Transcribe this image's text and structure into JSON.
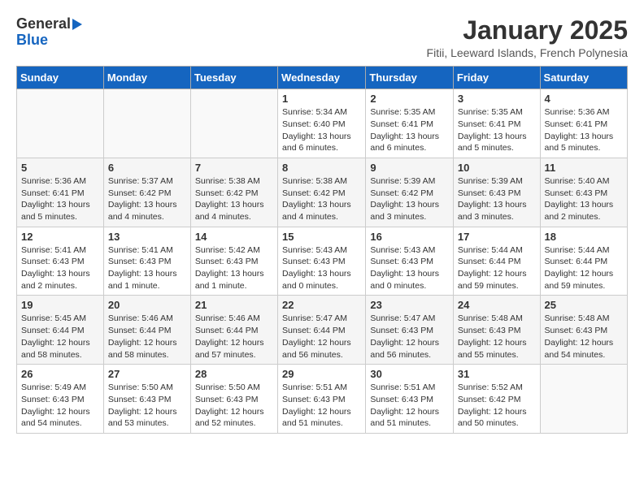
{
  "logo": {
    "general": "General",
    "blue": "Blue"
  },
  "title": "January 2025",
  "subtitle": "Fitii, Leeward Islands, French Polynesia",
  "weekdays": [
    "Sunday",
    "Monday",
    "Tuesday",
    "Wednesday",
    "Thursday",
    "Friday",
    "Saturday"
  ],
  "weeks": [
    [
      {
        "day": "",
        "info": ""
      },
      {
        "day": "",
        "info": ""
      },
      {
        "day": "",
        "info": ""
      },
      {
        "day": "1",
        "info": "Sunrise: 5:34 AM\nSunset: 6:40 PM\nDaylight: 13 hours\nand 6 minutes."
      },
      {
        "day": "2",
        "info": "Sunrise: 5:35 AM\nSunset: 6:41 PM\nDaylight: 13 hours\nand 6 minutes."
      },
      {
        "day": "3",
        "info": "Sunrise: 5:35 AM\nSunset: 6:41 PM\nDaylight: 13 hours\nand 5 minutes."
      },
      {
        "day": "4",
        "info": "Sunrise: 5:36 AM\nSunset: 6:41 PM\nDaylight: 13 hours\nand 5 minutes."
      }
    ],
    [
      {
        "day": "5",
        "info": "Sunrise: 5:36 AM\nSunset: 6:41 PM\nDaylight: 13 hours\nand 5 minutes."
      },
      {
        "day": "6",
        "info": "Sunrise: 5:37 AM\nSunset: 6:42 PM\nDaylight: 13 hours\nand 4 minutes."
      },
      {
        "day": "7",
        "info": "Sunrise: 5:38 AM\nSunset: 6:42 PM\nDaylight: 13 hours\nand 4 minutes."
      },
      {
        "day": "8",
        "info": "Sunrise: 5:38 AM\nSunset: 6:42 PM\nDaylight: 13 hours\nand 4 minutes."
      },
      {
        "day": "9",
        "info": "Sunrise: 5:39 AM\nSunset: 6:42 PM\nDaylight: 13 hours\nand 3 minutes."
      },
      {
        "day": "10",
        "info": "Sunrise: 5:39 AM\nSunset: 6:43 PM\nDaylight: 13 hours\nand 3 minutes."
      },
      {
        "day": "11",
        "info": "Sunrise: 5:40 AM\nSunset: 6:43 PM\nDaylight: 13 hours\nand 2 minutes."
      }
    ],
    [
      {
        "day": "12",
        "info": "Sunrise: 5:41 AM\nSunset: 6:43 PM\nDaylight: 13 hours\nand 2 minutes."
      },
      {
        "day": "13",
        "info": "Sunrise: 5:41 AM\nSunset: 6:43 PM\nDaylight: 13 hours\nand 1 minute."
      },
      {
        "day": "14",
        "info": "Sunrise: 5:42 AM\nSunset: 6:43 PM\nDaylight: 13 hours\nand 1 minute."
      },
      {
        "day": "15",
        "info": "Sunrise: 5:43 AM\nSunset: 6:43 PM\nDaylight: 13 hours\nand 0 minutes."
      },
      {
        "day": "16",
        "info": "Sunrise: 5:43 AM\nSunset: 6:43 PM\nDaylight: 13 hours\nand 0 minutes."
      },
      {
        "day": "17",
        "info": "Sunrise: 5:44 AM\nSunset: 6:44 PM\nDaylight: 12 hours\nand 59 minutes."
      },
      {
        "day": "18",
        "info": "Sunrise: 5:44 AM\nSunset: 6:44 PM\nDaylight: 12 hours\nand 59 minutes."
      }
    ],
    [
      {
        "day": "19",
        "info": "Sunrise: 5:45 AM\nSunset: 6:44 PM\nDaylight: 12 hours\nand 58 minutes."
      },
      {
        "day": "20",
        "info": "Sunrise: 5:46 AM\nSunset: 6:44 PM\nDaylight: 12 hours\nand 58 minutes."
      },
      {
        "day": "21",
        "info": "Sunrise: 5:46 AM\nSunset: 6:44 PM\nDaylight: 12 hours\nand 57 minutes."
      },
      {
        "day": "22",
        "info": "Sunrise: 5:47 AM\nSunset: 6:44 PM\nDaylight: 12 hours\nand 56 minutes."
      },
      {
        "day": "23",
        "info": "Sunrise: 5:47 AM\nSunset: 6:43 PM\nDaylight: 12 hours\nand 56 minutes."
      },
      {
        "day": "24",
        "info": "Sunrise: 5:48 AM\nSunset: 6:43 PM\nDaylight: 12 hours\nand 55 minutes."
      },
      {
        "day": "25",
        "info": "Sunrise: 5:48 AM\nSunset: 6:43 PM\nDaylight: 12 hours\nand 54 minutes."
      }
    ],
    [
      {
        "day": "26",
        "info": "Sunrise: 5:49 AM\nSunset: 6:43 PM\nDaylight: 12 hours\nand 54 minutes."
      },
      {
        "day": "27",
        "info": "Sunrise: 5:50 AM\nSunset: 6:43 PM\nDaylight: 12 hours\nand 53 minutes."
      },
      {
        "day": "28",
        "info": "Sunrise: 5:50 AM\nSunset: 6:43 PM\nDaylight: 12 hours\nand 52 minutes."
      },
      {
        "day": "29",
        "info": "Sunrise: 5:51 AM\nSunset: 6:43 PM\nDaylight: 12 hours\nand 51 minutes."
      },
      {
        "day": "30",
        "info": "Sunrise: 5:51 AM\nSunset: 6:43 PM\nDaylight: 12 hours\nand 51 minutes."
      },
      {
        "day": "31",
        "info": "Sunrise: 5:52 AM\nSunset: 6:42 PM\nDaylight: 12 hours\nand 50 minutes."
      },
      {
        "day": "",
        "info": ""
      }
    ]
  ]
}
